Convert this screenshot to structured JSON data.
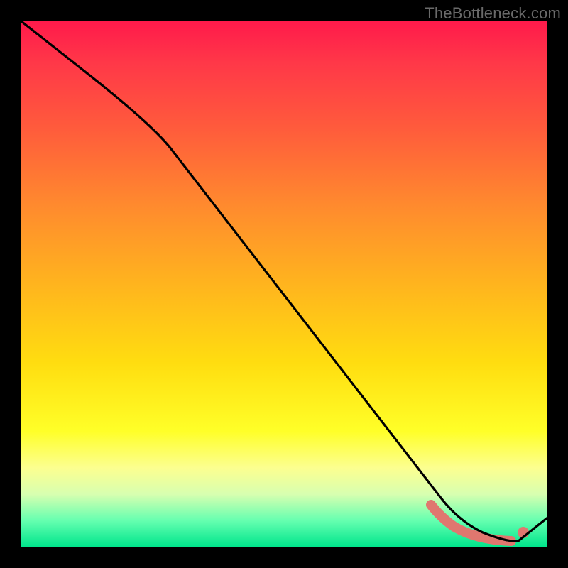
{
  "attribution": "TheBottleneck.com",
  "chart_data": {
    "type": "line",
    "title": "",
    "xlabel": "",
    "ylabel": "",
    "xlim": [
      0,
      100
    ],
    "ylim": [
      0,
      100
    ],
    "grid": false,
    "legend": false,
    "series": [
      {
        "name": "curve",
        "color": "#000000",
        "x": [
          0,
          10,
          20,
          30,
          40,
          50,
          60,
          70,
          78,
          82,
          86,
          90,
          94,
          100
        ],
        "y": [
          100,
          92,
          83,
          73,
          60,
          47,
          34,
          21,
          8,
          4,
          2,
          1,
          1,
          6
        ]
      }
    ],
    "optimal_band": {
      "color": "#e0776f",
      "x": [
        78,
        82,
        86,
        90,
        94
      ],
      "y": [
        8,
        4,
        2,
        1,
        1
      ]
    }
  }
}
